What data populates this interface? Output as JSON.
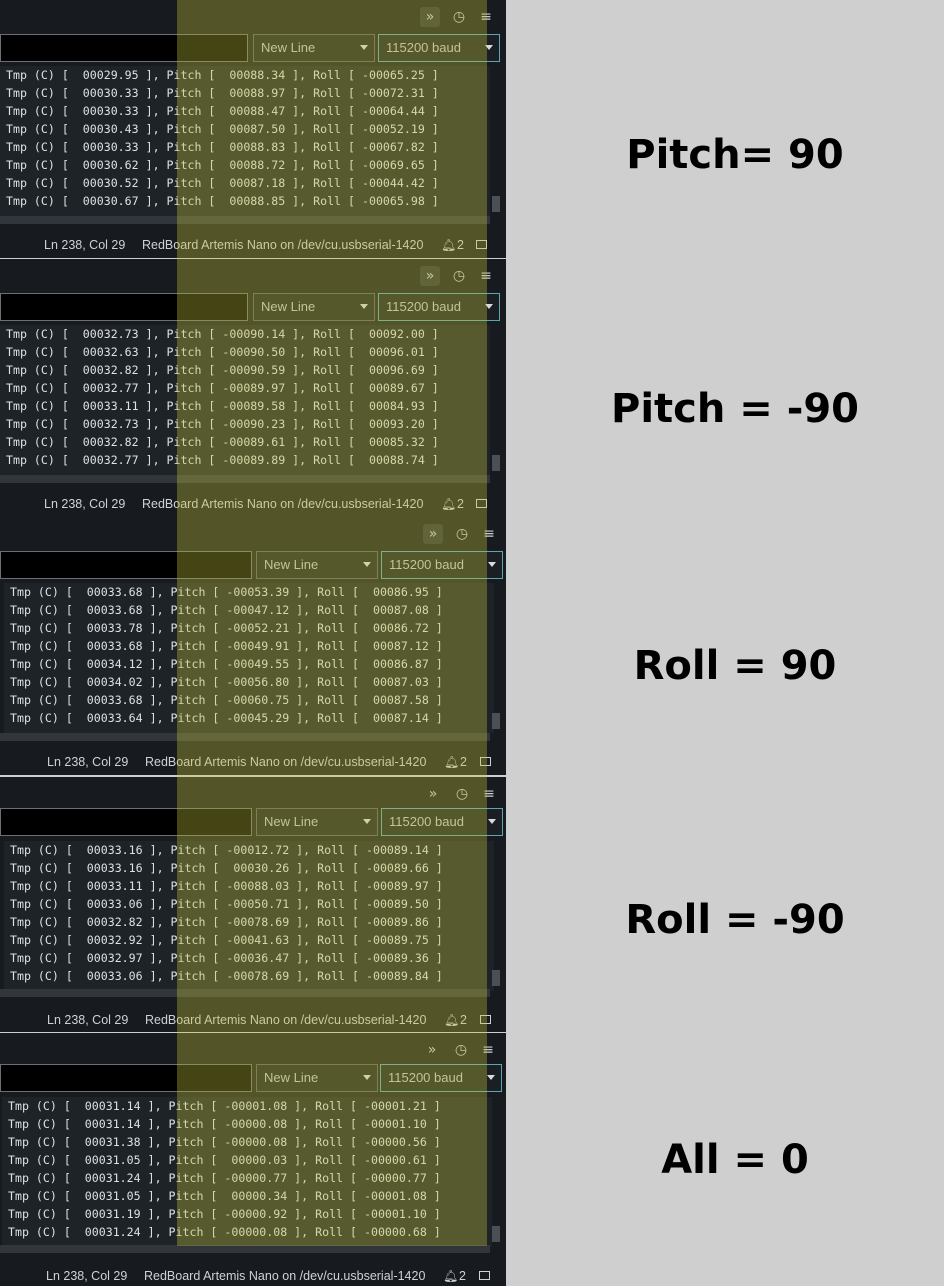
{
  "toolbar": {
    "collapse_icon": "chevron-double-down-icon",
    "timestamp_icon": "clock-icon",
    "clear_icon": "clear-output-icon"
  },
  "panels": [
    {
      "line_ending": "New Line",
      "baud": "115200 baud",
      "lines": [
        "Tmp (C) [  00029.95 ], Pitch [  00088.34 ], Roll [ -00065.25 ]",
        "Tmp (C) [  00030.33 ], Pitch [  00088.97 ], Roll [ -00072.31 ]",
        "Tmp (C) [  00030.33 ], Pitch [  00088.47 ], Roll [ -00064.44 ]",
        "Tmp (C) [  00030.43 ], Pitch [  00087.50 ], Roll [ -00052.19 ]",
        "Tmp (C) [  00030.33 ], Pitch [  00088.83 ], Roll [ -00067.82 ]",
        "Tmp (C) [  00030.62 ], Pitch [  00088.72 ], Roll [ -00069.65 ]",
        "Tmp (C) [  00030.52 ], Pitch [  00087.18 ], Roll [ -00044.42 ]",
        "Tmp (C) [  00030.67 ], Pitch [  00088.85 ], Roll [ -00065.98 ]"
      ],
      "status_position": "Ln 238, Col 29",
      "status_board": "RedBoard Artemis Nano on /dev/cu.usbserial-1420",
      "notifications": "2",
      "caption": "Pitch= 90"
    },
    {
      "line_ending": "New Line",
      "baud": "115200 baud",
      "lines": [
        "Tmp (C) [  00032.73 ], Pitch [ -00090.14 ], Roll [  00092.00 ]",
        "Tmp (C) [  00032.63 ], Pitch [ -00090.50 ], Roll [  00096.01 ]",
        "Tmp (C) [  00032.82 ], Pitch [ -00090.59 ], Roll [  00096.69 ]",
        "Tmp (C) [  00032.77 ], Pitch [ -00089.97 ], Roll [  00089.67 ]",
        "Tmp (C) [  00033.11 ], Pitch [ -00089.58 ], Roll [  00084.93 ]",
        "Tmp (C) [  00032.73 ], Pitch [ -00090.23 ], Roll [  00093.20 ]",
        "Tmp (C) [  00032.82 ], Pitch [ -00089.61 ], Roll [  00085.32 ]",
        "Tmp (C) [  00032.77 ], Pitch [ -00089.89 ], Roll [  00088.74 ]"
      ],
      "status_position": "Ln 238, Col 29",
      "status_board": "RedBoard Artemis Nano on /dev/cu.usbserial-1420",
      "notifications": "2",
      "caption": "Pitch = -90"
    },
    {
      "line_ending": "New Line",
      "baud": "115200 baud",
      "lines": [
        "Tmp (C) [  00033.68 ], Pitch [ -00053.39 ], Roll [  00086.95 ]",
        "Tmp (C) [  00033.68 ], Pitch [ -00047.12 ], Roll [  00087.08 ]",
        "Tmp (C) [  00033.78 ], Pitch [ -00052.21 ], Roll [  00086.72 ]",
        "Tmp (C) [  00033.68 ], Pitch [ -00049.91 ], Roll [  00087.12 ]",
        "Tmp (C) [  00034.12 ], Pitch [ -00049.55 ], Roll [  00086.87 ]",
        "Tmp (C) [  00034.02 ], Pitch [ -00056.80 ], Roll [  00087.03 ]",
        "Tmp (C) [  00033.68 ], Pitch [ -00060.75 ], Roll [  00087.58 ]",
        "Tmp (C) [  00033.64 ], Pitch [ -00045.29 ], Roll [  00087.14 ]"
      ],
      "status_position": "Ln 238, Col 29",
      "status_board": "RedBoard Artemis Nano on /dev/cu.usbserial-1420",
      "notifications": "2",
      "caption": "Roll = 90"
    },
    {
      "line_ending": "New Line",
      "baud": "115200 baud",
      "lines": [
        "Tmp (C) [  00033.16 ], Pitch [ -00012.72 ], Roll [ -00089.14 ]",
        "Tmp (C) [  00033.16 ], Pitch [  00030.26 ], Roll [ -00089.66 ]",
        "Tmp (C) [  00033.11 ], Pitch [ -00088.03 ], Roll [ -00089.97 ]",
        "Tmp (C) [  00033.06 ], Pitch [ -00050.71 ], Roll [ -00089.50 ]",
        "Tmp (C) [  00032.82 ], Pitch [ -00078.69 ], Roll [ -00089.86 ]",
        "Tmp (C) [  00032.92 ], Pitch [ -00041.63 ], Roll [ -00089.75 ]",
        "Tmp (C) [  00032.97 ], Pitch [ -00036.47 ], Roll [ -00089.36 ]",
        "Tmp (C) [  00033.06 ], Pitch [ -00078.69 ], Roll [ -00089.84 ]"
      ],
      "status_position": "Ln 238, Col 29",
      "status_board": "RedBoard Artemis Nano on /dev/cu.usbserial-1420",
      "notifications": "2",
      "caption": "Roll = -90"
    },
    {
      "line_ending": "New Line",
      "baud": "115200 baud",
      "lines": [
        "Tmp (C) [  00031.14 ], Pitch [ -00001.08 ], Roll [ -00001.21 ]",
        "Tmp (C) [  00031.14 ], Pitch [ -00000.08 ], Roll [ -00001.10 ]",
        "Tmp (C) [  00031.38 ], Pitch [ -00000.08 ], Roll [ -00000.56 ]",
        "Tmp (C) [  00031.05 ], Pitch [  00000.03 ], Roll [ -00000.61 ]",
        "Tmp (C) [  00031.24 ], Pitch [ -00000.77 ], Roll [ -00000.77 ]",
        "Tmp (C) [  00031.05 ], Pitch [  00000.34 ], Roll [ -00001.08 ]",
        "Tmp (C) [  00031.19 ], Pitch [ -00000.92 ], Roll [ -00001.10 ]",
        "Tmp (C) [  00031.24 ], Pitch [ -00000.08 ], Roll [ -00000.68 ]"
      ],
      "status_position": "Ln 238, Col 29",
      "status_board": "RedBoard Artemis Nano on /dev/cu.usbserial-1420",
      "notifications": "2",
      "caption": "All = 0"
    }
  ]
}
